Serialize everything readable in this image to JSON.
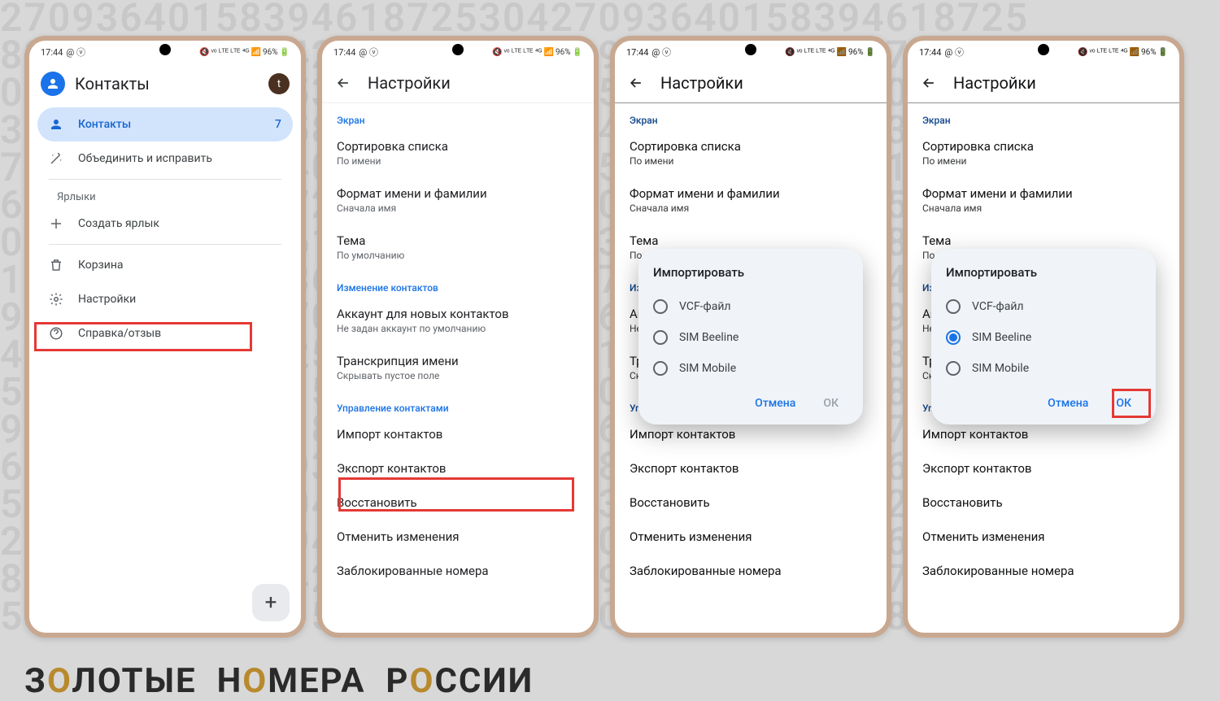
{
  "statusbar": {
    "time": "17:44",
    "battery": "96%",
    "signal_text": "ᵛᵒ ᴸᵀᴱ ᴸᵀᴱ ⁴ᴳ"
  },
  "screen1": {
    "title": "Контакты",
    "avatar_letter": "t",
    "nav": {
      "contacts": "Контакты",
      "contacts_count": "7",
      "merge_fix": "Объединить и исправить",
      "labels_header": "Ярлыки",
      "create_label": "Создать ярлык",
      "trash": "Корзина",
      "settings": "Настройки",
      "help": "Справка/отзыв"
    }
  },
  "screen2": {
    "title": "Настройки",
    "sections": {
      "screen": "Экран",
      "edit_contacts": "Изменение контактов",
      "manage_contacts": "Управление контактами"
    },
    "items": {
      "sort_list": "Сортировка списка",
      "sort_list_sub": "По имени",
      "name_format": "Формат имени и фамилии",
      "name_format_sub": "Сначала имя",
      "theme": "Тема",
      "theme_sub": "По умолчанию",
      "default_account": "Аккаунт для новых контактов",
      "default_account_sub": "Не задан аккаунт по умолчанию",
      "name_transcription": "Транскрипция имени",
      "name_transcription_sub": "Скрывать пустое поле",
      "import": "Импорт контактов",
      "export": "Экспорт контактов",
      "restore": "Восстановить",
      "undo": "Отменить изменения",
      "blocked": "Заблокированные номера"
    }
  },
  "dialog": {
    "title": "Импортировать",
    "option_vcf": "VCF-файл",
    "option_sim1": "SIM Beeline",
    "option_sim2": "SIM Mobile",
    "cancel": "Отмена",
    "ok": "ОК"
  },
  "footer": {
    "word1_pre": "З",
    "word1_o": "О",
    "word1_post": "ЛОТЫЕ",
    "word2_pre": "Н",
    "word2_o": "О",
    "word2_post": "МЕРА",
    "word3_pre": "Р",
    "word3_o": "О",
    "word3_post": "ССИИ"
  }
}
